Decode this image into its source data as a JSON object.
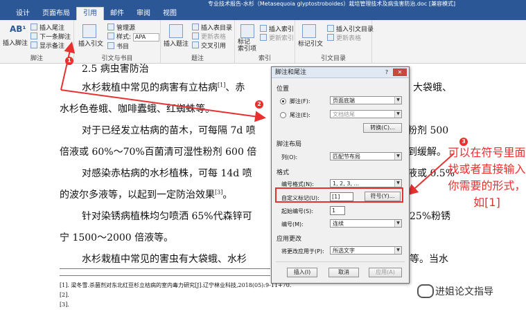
{
  "window": {
    "title": "专业技术报告-水杉（Metasequoia glyptostroboides）栽培管理技术及病虫害防治.doc [兼容模式]"
  },
  "tabs": [
    "设计",
    "页面布局",
    "引用",
    "邮件",
    "审阅",
    "视图"
  ],
  "active_tab": "引用",
  "ribbon": {
    "footnote_group": {
      "label": "脚注",
      "insert_footnote": "插入脚注",
      "insert_endnote": "插入尾注",
      "next_footnote": "下一条脚注",
      "show_notes": "显示备注",
      "ab_icon": "AB¹"
    },
    "citation_group": {
      "label": "引文与书目",
      "insert_citation": "插入引文",
      "manage_sources": "管理源",
      "style_label": "样式:",
      "style_value": "APA",
      "bibliography": "书目"
    },
    "caption_group": {
      "label": "题注",
      "insert_caption": "插入题注",
      "insert_table_of_figures": "插入表目录",
      "update_table": "更新表格",
      "cross_reference": "交叉引用"
    },
    "index_group": {
      "label": "索引",
      "mark_entry": "标记\n索引项",
      "insert_index": "插入索引",
      "update_index": "更新索引"
    },
    "toa_group": {
      "label": "引文目录",
      "mark_citation": "标记引文",
      "insert_toa": "插入引文目录",
      "update_toa": "更新表格"
    }
  },
  "document": {
    "heading": "2.5 病虫害防治",
    "lines": [
      "水杉栽植中常见的病害有立枯病",
      "、赤",
      "大袋蛾、",
      "水杉色卷蛾、咖啡蠹蛾、红蜘蛛等。",
      "对于已经发立枯病的苗木，可每隔 7d 喷",
      "粉剂 500",
      "倍液或 60%～70%百菌清可湿性粉剂 600 倍",
      "到缓解。",
      "对感染赤枯病的水杉植株，可每 14d 喷",
      "液或 0.5%",
      "的波尔多液等，以起到一定防治效果",
      "。",
      "针对染锈病植株均匀喷洒 65%代森锌可",
      "25%粉锈",
      "宁 1500～2000 倍液等。",
      "水杉栽植中常见的害虫有大袋蛾、水杉",
      "等。当水"
    ],
    "ref_marks": [
      "[1]",
      "[3]"
    ],
    "footnotes": [
      "[1]. 梁冬雪.杀菌剂对东北红豆杉立枯病的室内毒力研究[J].辽宁林业科技,2018(05):9-11+70.",
      "[2].",
      "[3]."
    ]
  },
  "dialog": {
    "title": "脚注和尾注",
    "help": "?",
    "close": "✕",
    "position_section": "位置",
    "footnote_label": "脚注(F):",
    "footnote_value": "页面底端",
    "endnote_label": "尾注(E):",
    "endnote_value": "文档结尾",
    "convert_button": "转换(C)...",
    "layout_section": "脚注布局",
    "columns_label": "列(O):",
    "columns_value": "匹配节布局",
    "format_section": "格式",
    "number_format_label": "编号格式(N):",
    "number_format_value": "1, 2, 3, ...",
    "custom_mark_label": "自定义标记(U):",
    "custom_mark_value": "[1]",
    "symbol_button": "符号(Y)...",
    "start_at_label": "起始编号(S):",
    "start_at_value": "1",
    "numbering_label": "编号(M):",
    "numbering_value": "连续",
    "apply_section": "应用更改",
    "apply_to_label": "将更改应用于(P):",
    "apply_to_value": "所选文字",
    "insert_button": "插入(I)",
    "cancel_button": "取消",
    "apply_button": "应用(A)"
  },
  "annotations": {
    "markers": [
      "1",
      "2",
      "3"
    ],
    "note": "可以在符号里面找或者直接输入你需要的形式，如[1]",
    "color": "#e8302f"
  },
  "watermark": "进姐论文指导"
}
